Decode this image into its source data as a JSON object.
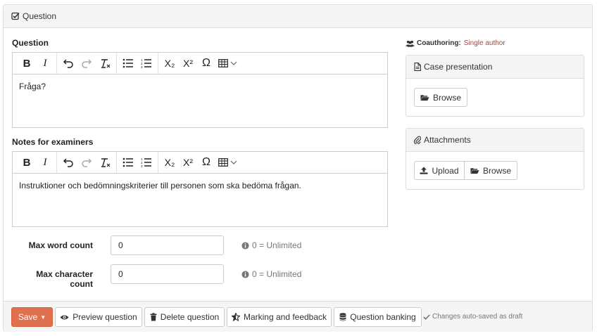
{
  "panel": {
    "title": "Question"
  },
  "question_editor": {
    "label": "Question",
    "content": "Fråga?"
  },
  "notes_editor": {
    "label": "Notes for examiners",
    "content": "Instruktioner och bedömningskriterier till personen som ska bedöma frågan."
  },
  "toolbar": {
    "bold": "B",
    "italic": "I",
    "subscript": "X₂",
    "superscript": "X²",
    "omega": "Ω"
  },
  "limits": {
    "max_word_label": "Max word count",
    "max_word_value": "0",
    "max_char_label": "Max character count",
    "max_char_value": "0",
    "hint": "0 = Unlimited"
  },
  "coauthoring": {
    "label": "Coauthoring:",
    "value": "Single author"
  },
  "case_presentation": {
    "title": "Case presentation",
    "browse": "Browse"
  },
  "attachments": {
    "title": "Attachments",
    "upload": "Upload",
    "browse": "Browse"
  },
  "footer": {
    "save": "Save",
    "preview": "Preview question",
    "delete": "Delete question",
    "marking": "Marking and feedback",
    "banking": "Question banking",
    "autosave": "Changes auto-saved as draft"
  },
  "colors": {
    "save_button": "#e0714f",
    "coauthoring_value": "#a94442",
    "panel_header": "#f5f5f5"
  }
}
